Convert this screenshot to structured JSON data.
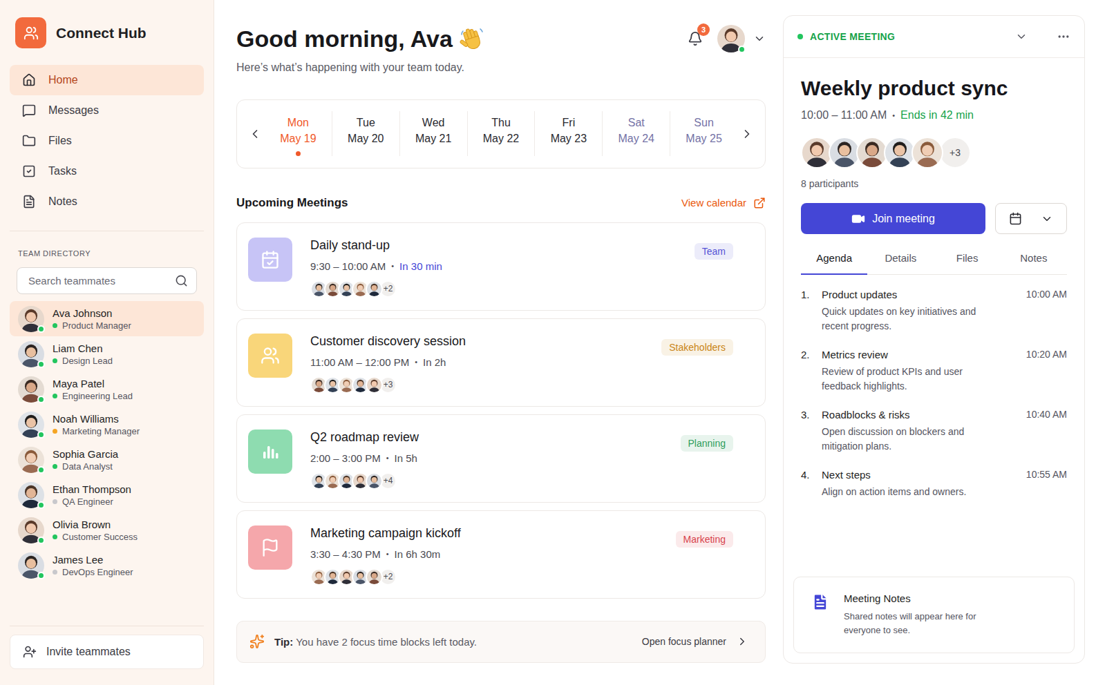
{
  "app": {
    "name": "Connect Hub"
  },
  "nav": [
    {
      "label": "Home",
      "selected": true
    },
    {
      "label": "Messages",
      "selected": false
    },
    {
      "label": "Files",
      "selected": false
    },
    {
      "label": "Tasks",
      "selected": false
    },
    {
      "label": "Notes",
      "selected": false
    }
  ],
  "directory": {
    "title": "TEAM DIRECTORY",
    "search_placeholder": "Search teammates",
    "members": [
      {
        "name": "Ava Johnson",
        "role": "Product Manager",
        "color": "#22c55e",
        "online": true,
        "selected": true
      },
      {
        "name": "Liam Chen",
        "role": "Design Lead",
        "color": "#22c55e",
        "online": true,
        "selected": false
      },
      {
        "name": "Maya Patel",
        "role": "Engineering Lead",
        "color": "#22c55e",
        "online": true,
        "selected": false
      },
      {
        "name": "Noah Williams",
        "role": "Marketing Manager",
        "color": "#f5a524",
        "online": true,
        "selected": false
      },
      {
        "name": "Sophia Garcia",
        "role": "Data Analyst",
        "color": "#22c55e",
        "online": true,
        "selected": false
      },
      {
        "name": "Ethan Thompson",
        "role": "QA Engineer",
        "color": "#c8c8cc",
        "online": true,
        "selected": false
      },
      {
        "name": "Olivia Brown",
        "role": "Customer Success",
        "color": "#22c55e",
        "online": true,
        "selected": false
      },
      {
        "name": "James Lee",
        "role": "DevOps Engineer",
        "color": "#c8c8cc",
        "online": true,
        "selected": false
      }
    ]
  },
  "invite": {
    "label": "Invite teammates"
  },
  "header": {
    "greeting": "Good morning, Ava",
    "subtitle": "Here’s what’s happening with your team today.",
    "notifications": "3",
    "user_online": true
  },
  "week": [
    {
      "day": "Mon",
      "date": "May 19",
      "selected": true,
      "weekend": false
    },
    {
      "day": "Tue",
      "date": "May 20",
      "selected": false,
      "weekend": false
    },
    {
      "day": "Wed",
      "date": "May 21",
      "selected": false,
      "weekend": false
    },
    {
      "day": "Thu",
      "date": "May 22",
      "selected": false,
      "weekend": false
    },
    {
      "day": "Fri",
      "date": "May 23",
      "selected": false,
      "weekend": false
    },
    {
      "day": "Sat",
      "date": "May 24",
      "selected": false,
      "weekend": true
    },
    {
      "day": "Sun",
      "date": "May 25",
      "selected": false,
      "weekend": true
    }
  ],
  "meetings_section": {
    "title": "Upcoming Meetings",
    "link": "View calendar"
  },
  "meetings": [
    {
      "title": "Daily stand-up",
      "time": "9:30 – 10:00 AM",
      "separator": "•",
      "relative": "In 30 min",
      "soon": true,
      "avatars": 5,
      "extra": "+2",
      "tag": "Team",
      "color": "#c7c4f6",
      "tag_color": "#5655d6"
    },
    {
      "title": "Customer discovery session",
      "time": "11:00 AM – 12:00 PM",
      "separator": "•",
      "relative": "In 2h",
      "soon": false,
      "avatars": 5,
      "extra": "+3",
      "tag": "Stakeholders",
      "color": "#f9d67a",
      "tag_color": "#c98516"
    },
    {
      "title": "Q2 roadmap review",
      "time": "2:00 – 3:00 PM",
      "separator": "•",
      "relative": "In 5h",
      "soon": false,
      "avatars": 5,
      "extra": "+4",
      "tag": "Planning",
      "color": "#8edcb0",
      "tag_color": "#2e9d5b"
    },
    {
      "title": "Marketing campaign kickoff",
      "time": "3:30 – 4:30 PM",
      "separator": "•",
      "relative": "In 6h 30m",
      "soon": false,
      "avatars": 5,
      "extra": "+2",
      "tag": "Marketing",
      "color": "#f5a7ab",
      "tag_color": "#d8434d"
    }
  ],
  "tip": {
    "label": "Tip:",
    "text": "You have 2 focus time blocks left today.",
    "action": "Open focus planner"
  },
  "active_meeting": {
    "status": "ACTIVE MEETING",
    "title": "Weekly product sync",
    "time": "10:00 – 11:00 AM",
    "separator": "•",
    "ends": "Ends in 42 min",
    "avatars": 5,
    "extra": "+3",
    "participants": "8 participants",
    "join": "Join meeting",
    "tabs": [
      {
        "label": "Agenda",
        "selected": true
      },
      {
        "label": "Details",
        "selected": false
      },
      {
        "label": "Files",
        "selected": false
      },
      {
        "label": "Notes",
        "selected": false
      }
    ],
    "agenda": [
      {
        "number": "1.",
        "title": "Product updates",
        "description": "Quick updates on key initiatives and recent progress.",
        "time": "10:00 AM"
      },
      {
        "number": "2.",
        "title": "Metrics review",
        "description": "Review of product KPIs and user feedback highlights.",
        "time": "10:20 AM"
      },
      {
        "number": "3.",
        "title": "Roadblocks & risks",
        "description": "Open discussion on blockers and mitigation plans.",
        "time": "10:40 AM"
      },
      {
        "number": "4.",
        "title": "Next steps",
        "description": "Align on action items and owners.",
        "time": "10:55 AM"
      }
    ],
    "notes": {
      "title": "Meeting Notes",
      "description": "Shared notes will appear here for everyone to see."
    }
  }
}
